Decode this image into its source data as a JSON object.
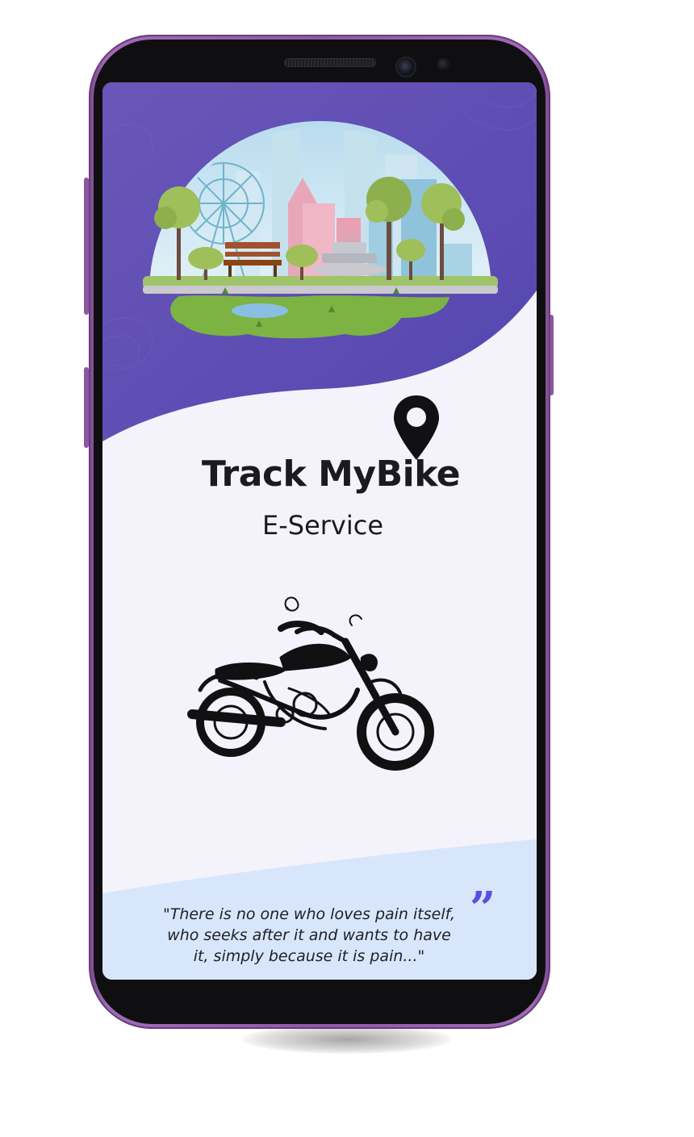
{
  "app": {
    "title": "Track MyBike",
    "subtitle": "E-Service"
  },
  "quote": {
    "mark": "”",
    "lines": [
      "\"There is no one who loves pain itself,",
      "who seeks after it and wants to have",
      "it, simply because it is pain...\""
    ]
  },
  "icons": {
    "pin": "location-pin-icon",
    "bike": "motorcycle-icon",
    "illustration": "city-park-illustration",
    "quote": "quote-icon"
  },
  "colors": {
    "header_purple": "#5a4ab0",
    "header_purple_light": "#7a63c2",
    "screen_bg": "#f4f3fb",
    "quote_bg": "#d7e6fb",
    "accent": "#5b4fe0",
    "phone_frame": "#8e5aa4",
    "text_dark": "#1a1a22"
  }
}
